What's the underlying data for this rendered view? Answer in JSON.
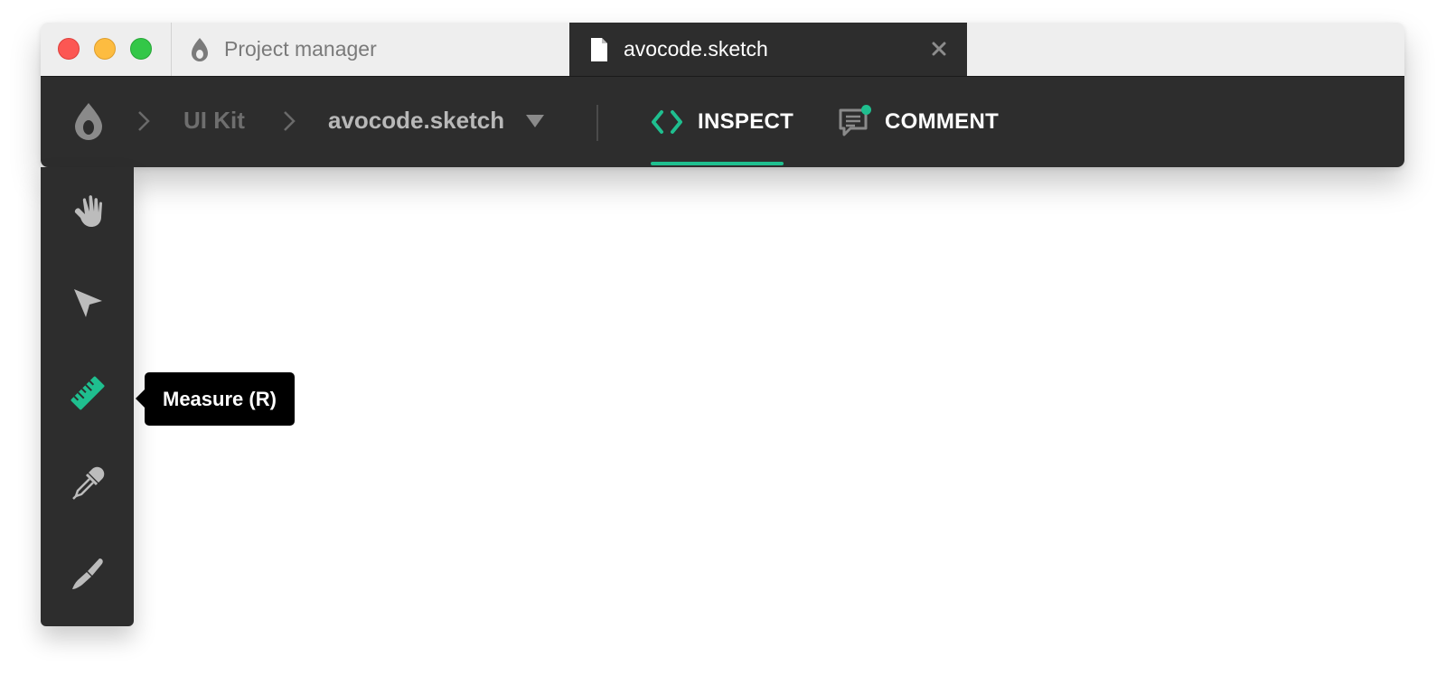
{
  "tabs": [
    {
      "title": "Project manager",
      "icon": "avocode-logo-icon",
      "active": false
    },
    {
      "title": "avocode.sketch",
      "icon": "document-icon",
      "active": true,
      "closable": true
    }
  ],
  "breadcrumb": {
    "items": [
      "UI Kit",
      "avocode.sketch"
    ],
    "has_dropdown": true
  },
  "modes": [
    {
      "label": "INSPECT",
      "icon": "code-brackets-icon",
      "active": true
    },
    {
      "label": "COMMENT",
      "icon": "comment-icon",
      "active": false,
      "has_notification": true
    }
  ],
  "tools": [
    {
      "name": "hand",
      "icon": "hand-icon",
      "active": false
    },
    {
      "name": "select",
      "icon": "cursor-arrow-icon",
      "active": false
    },
    {
      "name": "measure",
      "icon": "ruler-icon",
      "active": true
    },
    {
      "name": "eyedropper",
      "icon": "eyedropper-icon",
      "active": false
    },
    {
      "name": "slice",
      "icon": "knife-icon",
      "active": false
    }
  ],
  "tooltip": {
    "text": "Measure (R)"
  },
  "colors": {
    "accent": "#1fbf8f",
    "toolbar_bg": "#2d2d2d",
    "tabbar_bg": "#eeeeee",
    "icon_gray": "#a8a8a8",
    "tooltip_bg": "#000000"
  }
}
